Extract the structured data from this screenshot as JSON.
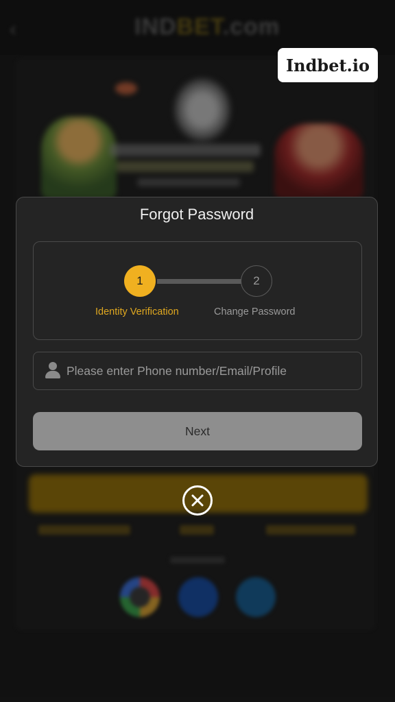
{
  "background": {
    "logo_text": "INDBET.com",
    "back_icon": "chevron-left-icon",
    "social_icons": [
      "google-icon",
      "facebook-icon",
      "telegram-icon"
    ]
  },
  "watermark": {
    "text": "Indbet.io"
  },
  "modal": {
    "title": "Forgot Password",
    "steps": [
      {
        "number": "1",
        "label": "Identity Verification",
        "active": true
      },
      {
        "number": "2",
        "label": "Change Password",
        "active": false
      }
    ],
    "input": {
      "icon": "user-icon",
      "value": "",
      "placeholder": "Please enter Phone number/Email/Profile"
    },
    "next_button": "Next",
    "close_icon": "close-circle-icon"
  },
  "colors": {
    "accent": "#f0b020",
    "modal_bg": "#242424",
    "button_disabled": "#8e8e8e"
  }
}
